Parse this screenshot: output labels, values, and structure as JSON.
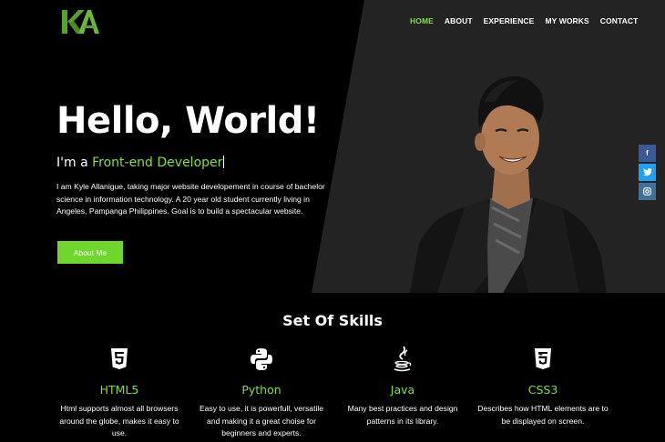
{
  "nav": {
    "items": [
      {
        "label": "HOME",
        "active": true
      },
      {
        "label": "ABOUT",
        "active": false
      },
      {
        "label": "EXPERIENCE",
        "active": false
      },
      {
        "label": "MY WORKS",
        "active": false
      },
      {
        "label": "CONTACT",
        "active": false
      }
    ]
  },
  "logo_text": "KA",
  "hero": {
    "title": "Hello, World!",
    "sub_prefix": "I'm a ",
    "sub_role": "Front-end Developer",
    "description": "I am Kyle Allanigue, taking major website developement in course of bachelor science in information technology. A 20 year old student currently living in Angeles, Pampanga Philippines. Goal is to build a spectacular website.",
    "button_label": "About Me"
  },
  "social": {
    "facebook": "f",
    "twitter": "t",
    "instagram": "ig"
  },
  "skills": {
    "title": "Set Of Skills",
    "items": [
      {
        "name": "HTML5",
        "icon": "html5-icon",
        "description": "Html supports almost all browsers around the globe, makes it easy to use."
      },
      {
        "name": "Python",
        "icon": "python-icon",
        "description": "Easy to use, it is powerfull, versatile and making it a great choise for beginners and experts."
      },
      {
        "name": "Java",
        "icon": "java-icon",
        "description": "Many best practices and design patterns in its library."
      },
      {
        "name": "CSS3",
        "icon": "css3-icon",
        "description": "Describes how HTML elements are to be displayed on screen."
      }
    ]
  },
  "colors": {
    "accent": "#7ee235",
    "button": "#6fd62e",
    "hero_right": "#232323",
    "background": "#000000"
  }
}
